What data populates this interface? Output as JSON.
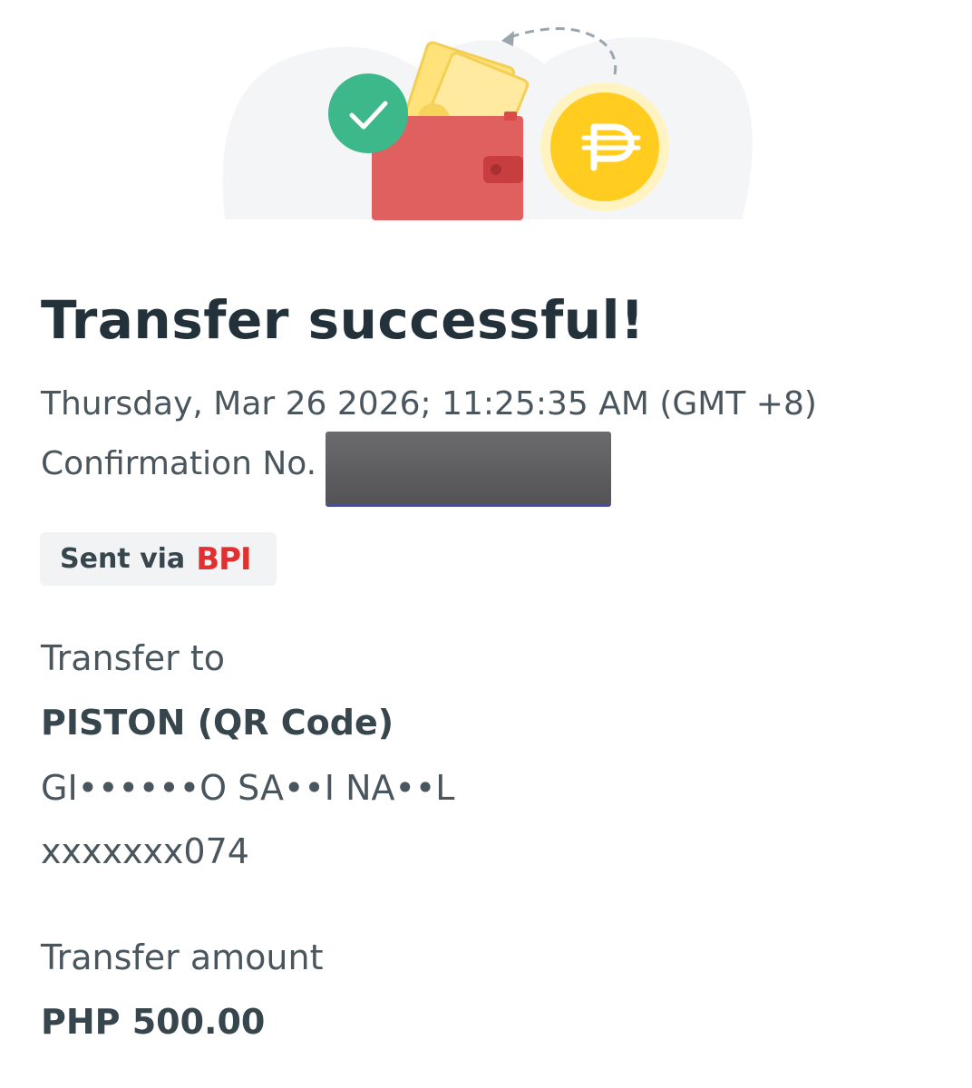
{
  "header": {
    "title": "Transfer successful!",
    "datetime": "Thursday, Mar 26 2026; 11:25:35 AM (GMT +8)",
    "confirmation_label": "Confirmation No."
  },
  "sent_via": {
    "prefix": "Sent via",
    "bank": "BPI",
    "bank_color": "#e03030"
  },
  "transfer_to": {
    "label": "Transfer to",
    "recipient": "PISTON (QR Code)",
    "account_name": "GI••••••O SA••I NA••L",
    "account_number": "xxxxxxx074"
  },
  "transfer_amount": {
    "label": "Transfer amount",
    "value": "PHP 500.00"
  },
  "illustration": {
    "icons": [
      "check-icon",
      "wallet-icon",
      "cash-icon",
      "peso-coin-icon",
      "dashed-arrow-icon"
    ],
    "colors": {
      "check": "#3db88b",
      "wallet": "#e06060",
      "coin": "#ffcc1f",
      "cash": "#ffe27a"
    }
  }
}
